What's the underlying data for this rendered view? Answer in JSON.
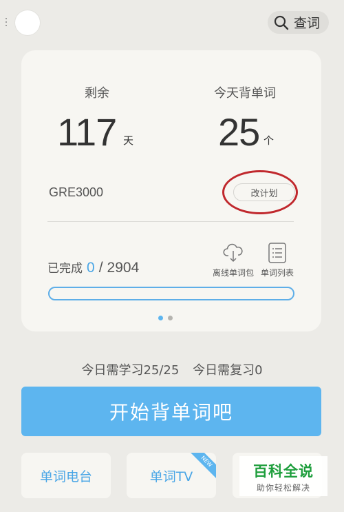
{
  "header": {
    "search_label": "查词"
  },
  "plan_card": {
    "remaining_label": "剩余",
    "remaining_days": "117",
    "remaining_unit": "天",
    "today_label": "今天背单词",
    "today_count": "25",
    "today_unit": "个",
    "book_name": "GRE3000",
    "change_plan_label": "改计划",
    "completed_label": "已完成",
    "completed_count": "0",
    "separator": "/",
    "total_words": "2904",
    "progress_fraction": 0,
    "offline_pack_label": "离线单词包",
    "word_list_label": "单词列表",
    "pager_active_index": 0,
    "pager_count": 2
  },
  "today": {
    "learn_label": "今日需学习25/25",
    "review_label": "今日需复习0"
  },
  "start_button_label": "开始背单词吧",
  "tiles": {
    "radio_label": "单词电台",
    "tv_label": "单词TV",
    "tv_badge": "NEW"
  },
  "watermark": {
    "title": "百科全说",
    "subtitle": "助你轻松解决"
  },
  "colors": {
    "accent": "#5db5ef",
    "annotation_circle": "#c0282d",
    "background": "#ecebe7",
    "card": "#f7f6f2"
  }
}
